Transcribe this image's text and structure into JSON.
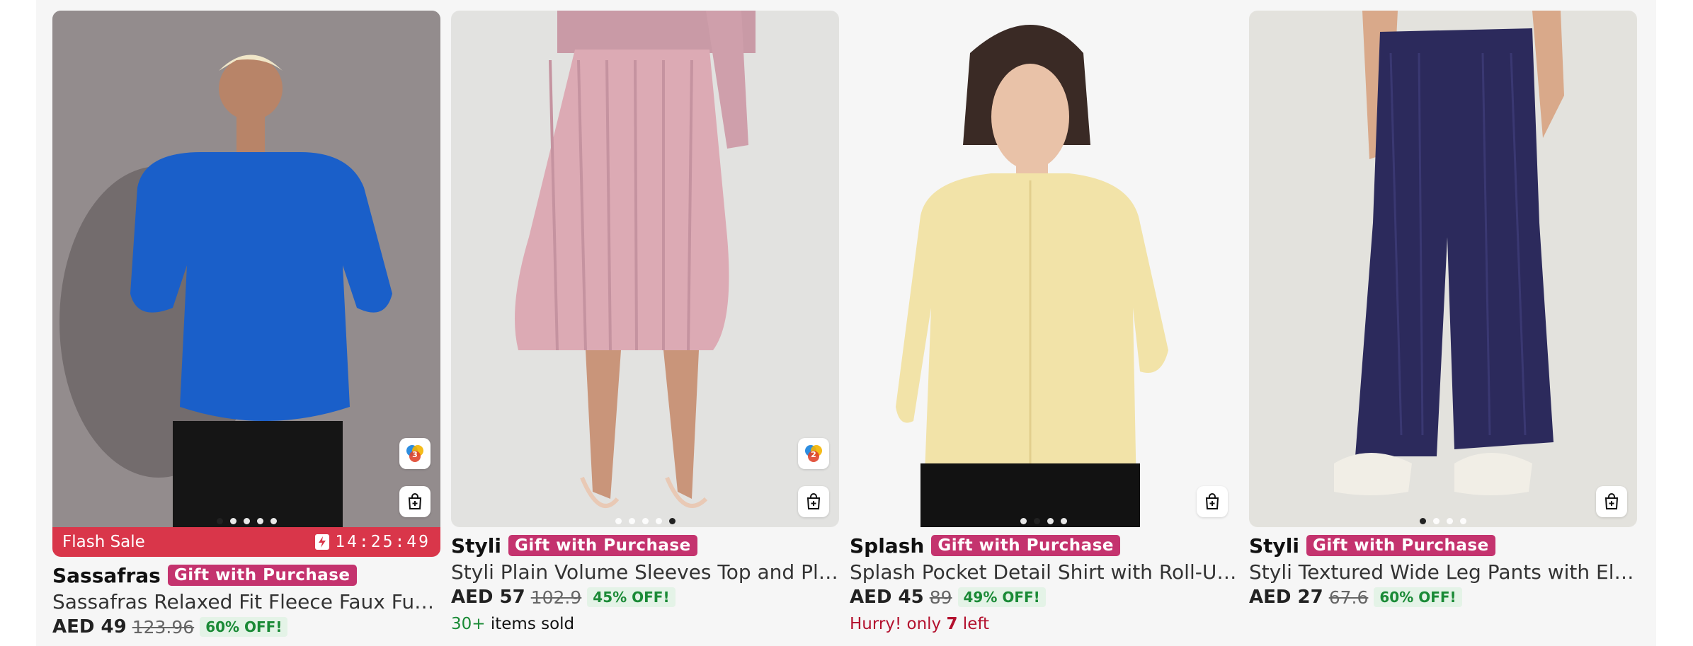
{
  "products": [
    {
      "brand": "Sassafras",
      "badge": "Gift with Purchase",
      "name": "Sassafras Relaxed Fit Fleece Faux Fur P...",
      "price": "AED 49",
      "old_price": "123.96",
      "discount": "60% OFF!",
      "flash_label": "Flash Sale",
      "timer": "14:25:49",
      "color_count": "3",
      "dots": 5,
      "active_dot": 1
    },
    {
      "brand": "Styli",
      "badge": "Gift with Purchase",
      "name": "Styli Plain Volume Sleeves Top and Plea...",
      "price": "AED 57",
      "old_price": "102.9",
      "discount": "45% OFF!",
      "note_hl": "30+",
      "note_rest": " items sold",
      "color_count": "2",
      "dots": 5,
      "active_dot": 5
    },
    {
      "brand": "Splash",
      "badge": "Gift with Purchase",
      "name": "Splash Pocket Detail Shirt with Roll-Up ...",
      "price": "AED 45",
      "old_price": "89",
      "discount": "49% OFF!",
      "note_a": "Hurry! only ",
      "note_b": "7",
      "note_c": " left",
      "dots": 4,
      "active_dot": 2
    },
    {
      "brand": "Styli",
      "badge": "Gift with Purchase",
      "name": "Styli Textured Wide Leg Pants with Elas...",
      "price": "AED 27",
      "old_price": "67.6",
      "discount": "60% OFF!",
      "dots": 4,
      "active_dot": 1
    }
  ],
  "colors": {
    "flash": "#d9364a",
    "gift_badge": "#c4336e",
    "discount_bg": "#e4f3e7",
    "discount_text": "#1a8a36",
    "hurry_text": "#b3112e"
  }
}
